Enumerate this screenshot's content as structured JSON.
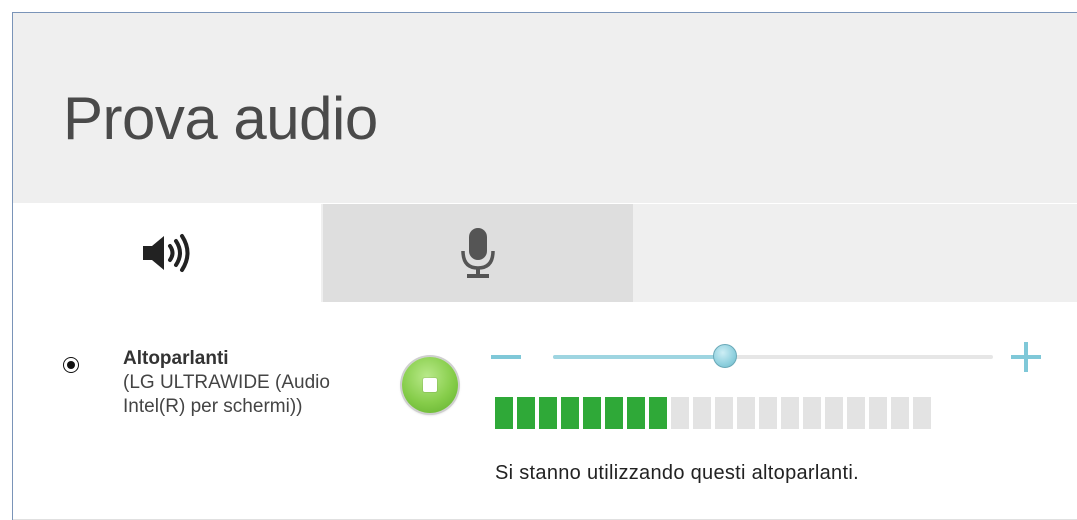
{
  "dialog": {
    "title": "Prova audio"
  },
  "tabs": [
    {
      "icon": "speaker-icon",
      "selected": true
    },
    {
      "icon": "microphone-icon",
      "selected": false
    }
  ],
  "device": {
    "selected": true,
    "name": "Altoparlanti",
    "description": "(LG ULTRAWIDE (Audio Intel(R) per schermi))",
    "status": "Si stanno utilizzando questi altoparlanti."
  },
  "volume": {
    "level_fraction": 0.39
  },
  "meter": {
    "total_segments": 20,
    "active_segments": 8
  },
  "colors": {
    "accent": "#7fc8d8",
    "meter_on": "#2fa938",
    "meter_off": "#e3e3e3",
    "play_green": "#86cd4a"
  }
}
